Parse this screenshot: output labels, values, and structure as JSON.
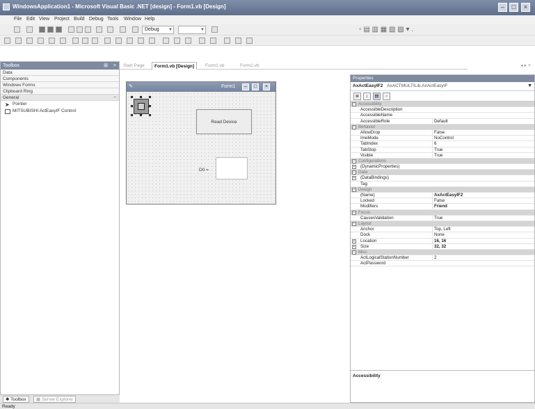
{
  "window": {
    "title": "WindowsApplication1 - Microsoft Visual Basic .NET [design] - Form1.vb [Design]"
  },
  "menu": [
    "File",
    "Edit",
    "View",
    "Project",
    "Build",
    "Debug",
    "Tools",
    "Window",
    "Help"
  ],
  "toolbar": {
    "config_value": "Debug"
  },
  "toolbox": {
    "title": "Toolbox",
    "sections": [
      "Data",
      "Components",
      "Windows Forms",
      "Clipboard Ring",
      "General"
    ],
    "items": [
      "Pointer",
      "MITSUBISHI ActEasyIF Control"
    ]
  },
  "bottom_tabs": [
    "Toolbox",
    "Server Explorer"
  ],
  "status": "Ready",
  "doc_tabs": [
    "Start Page",
    "Form1.vb [Design]",
    "Form1.vb",
    "Form1.vb"
  ],
  "form": {
    "title": "Form1",
    "read_button": "Read Device",
    "d0_label": "D0 ="
  },
  "properties": {
    "header": "Properties",
    "object_name": "AxActEasyIF2",
    "object_type": "AxACTMULTILib.AxActEasyIF",
    "rows": [
      {
        "kind": "cat",
        "name": "Accessibility"
      },
      {
        "kind": "prop",
        "name": "AccessibleDescription",
        "value": ""
      },
      {
        "kind": "prop",
        "name": "AccessibleName",
        "value": ""
      },
      {
        "kind": "prop",
        "name": "AccessibleRole",
        "value": "Default"
      },
      {
        "kind": "cat",
        "name": "Behavior"
      },
      {
        "kind": "prop",
        "name": "AllowDrop",
        "value": "False"
      },
      {
        "kind": "prop",
        "name": "ImeMode",
        "value": "NoControl"
      },
      {
        "kind": "prop",
        "name": "TabIndex",
        "value": "6"
      },
      {
        "kind": "prop",
        "name": "TabStop",
        "value": "True"
      },
      {
        "kind": "prop",
        "name": "Visible",
        "value": "True"
      },
      {
        "kind": "cat",
        "name": "Configurations"
      },
      {
        "kind": "expand",
        "name": "(DynamicProperties)",
        "value": ""
      },
      {
        "kind": "cat",
        "name": "Data"
      },
      {
        "kind": "expand",
        "name": "(DataBindings)",
        "value": ""
      },
      {
        "kind": "prop",
        "name": "Tag",
        "value": ""
      },
      {
        "kind": "cat",
        "name": "Design"
      },
      {
        "kind": "prop",
        "name": "(Name)",
        "value": "AxActEasyIF2",
        "bold": true
      },
      {
        "kind": "prop",
        "name": "Locked",
        "value": "False"
      },
      {
        "kind": "prop",
        "name": "Modifiers",
        "value": "Friend",
        "bold": true
      },
      {
        "kind": "cat",
        "name": "Focus"
      },
      {
        "kind": "prop",
        "name": "CausesValidation",
        "value": "True"
      },
      {
        "kind": "cat",
        "name": "Layout"
      },
      {
        "kind": "prop",
        "name": "Anchor",
        "value": "Top, Left"
      },
      {
        "kind": "prop",
        "name": "Dock",
        "value": "None"
      },
      {
        "kind": "expand",
        "name": "Location",
        "value": "16, 16",
        "bold": true
      },
      {
        "kind": "expand",
        "name": "Size",
        "value": "32, 32",
        "bold": true
      },
      {
        "kind": "cat",
        "name": "Misc"
      },
      {
        "kind": "prop",
        "name": "ActLogicalStationNumber",
        "value": "2"
      },
      {
        "kind": "prop",
        "name": "ActPassword",
        "value": ""
      }
    ],
    "description_title": "Accessibility"
  }
}
